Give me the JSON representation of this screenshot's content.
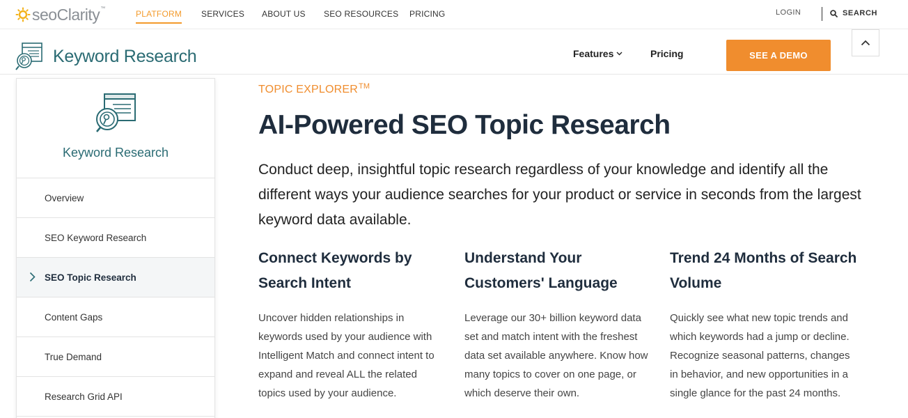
{
  "topnav": {
    "logo": {
      "seo": "seo",
      "clarity": "Clarity",
      "tm": "™"
    },
    "items": [
      {
        "label": "PLATFORM",
        "active": true
      },
      {
        "label": "SERVICES",
        "active": false
      },
      {
        "label": "ABOUT US",
        "active": false
      },
      {
        "label": "SEO RESOURCES",
        "active": false
      },
      {
        "label": "PRICING",
        "active": false
      }
    ],
    "login": "LOGIN",
    "search": "SEARCH"
  },
  "product_bar": {
    "title": "Keyword Research",
    "features": "Features",
    "pricing": "Pricing",
    "demo_button": "SEE A DEMO"
  },
  "sidebar": {
    "title": "Keyword Research",
    "items": [
      {
        "label": "Overview",
        "active": false
      },
      {
        "label": "SEO Keyword Research",
        "active": false
      },
      {
        "label": "SEO Topic Research",
        "active": true
      },
      {
        "label": "Content Gaps",
        "active": false
      },
      {
        "label": "True Demand",
        "active": false
      },
      {
        "label": "Research Grid API",
        "active": false
      }
    ]
  },
  "main": {
    "eyebrow": "TOPIC EXPLORER",
    "eyebrow_tm": "TM",
    "title": "AI-Powered SEO Topic Research",
    "description": "Conduct deep, insightful topic research regardless of your knowledge and identify all the different ways your audience searches for your product or service in seconds from the largest keyword data available.",
    "columns": [
      {
        "title": "Connect Keywords by Search Intent",
        "text": "Uncover hidden relationships in keywords used by your audience with Intelligent Match and connect intent to expand and reveal ALL the related topics used by your audience."
      },
      {
        "title": "Understand Your Customers' Language",
        "text": "Leverage our 30+ billion keyword data set and match intent with the freshest data set available anywhere. Know how many topics to cover on one page, or which deserve their own."
      },
      {
        "title": "Trend 24 Months of Search Volume",
        "text": "Quickly see what new topic trends and which keywords had a jump or decline. Recognize seasonal patterns, changes in behavior, and new opportunities in a single glance for the past 24 months."
      }
    ]
  },
  "colors": {
    "accent": "#f08d2e",
    "teal": "#2a6b73",
    "heading": "#1f2d3d"
  },
  "icons": [
    "sun-logo-icon",
    "search-icon",
    "chevron-down-icon",
    "chevron-up-icon",
    "keyword-research-icon",
    "chevron-right-icon"
  ]
}
